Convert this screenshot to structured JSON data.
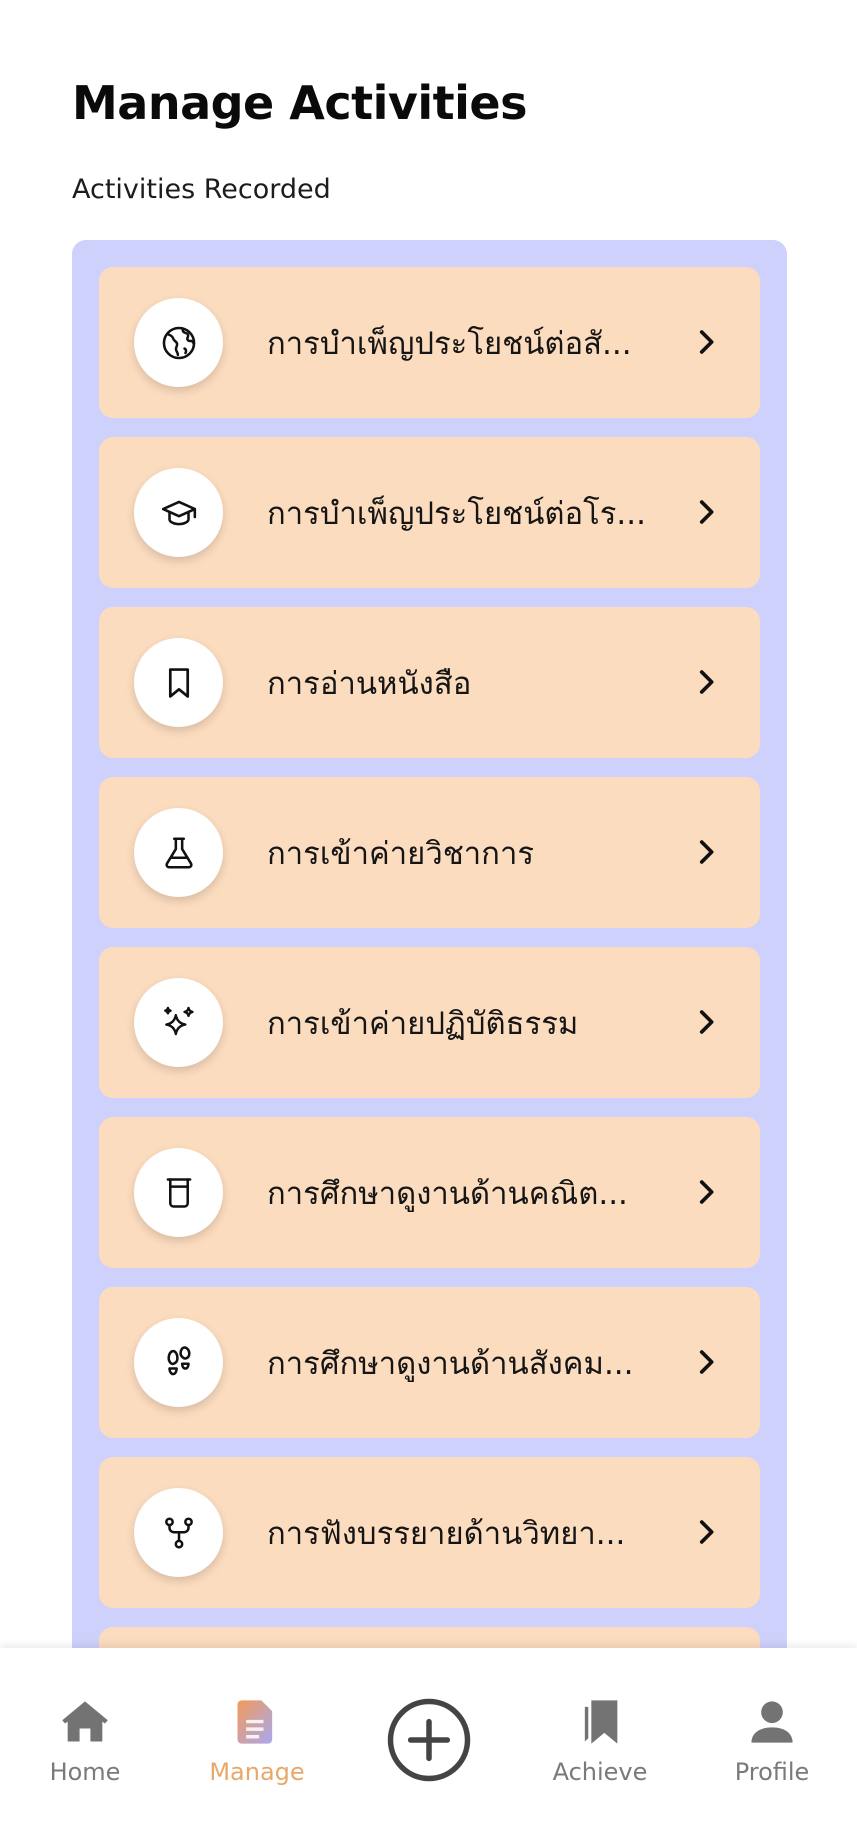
{
  "page": {
    "title": "Manage Activities",
    "subtitle": "Activities Recorded"
  },
  "activities": [
    {
      "label": "การบำเพ็ญประโยชน์ต่อสั...",
      "icon": "globe-icon"
    },
    {
      "label": "การบำเพ็ญประโยชน์ต่อโร...",
      "icon": "graduation-cap-icon"
    },
    {
      "label": "การอ่านหนังสือ",
      "icon": "bookmark-icon"
    },
    {
      "label": "การเข้าค่ายวิชาการ",
      "icon": "flask-icon"
    },
    {
      "label": "การเข้าค่ายปฏิบัติธรรม",
      "icon": "sparkles-icon"
    },
    {
      "label": "การศึกษาดูงานด้านคณิต...",
      "icon": "beaker-icon"
    },
    {
      "label": "การศึกษาดูงานด้านสังคม...",
      "icon": "footprints-icon"
    },
    {
      "label": "การฟังบรรยายด้านวิทยา...",
      "icon": "git-fork-icon"
    }
  ],
  "nav": {
    "items": [
      {
        "label": "Home",
        "icon": "home-icon",
        "active": false
      },
      {
        "label": "Manage",
        "icon": "document-icon",
        "active": true
      },
      {
        "label": "Achieve",
        "icon": "bookmarks-icon",
        "active": false
      },
      {
        "label": "Profile",
        "icon": "user-icon",
        "active": false
      }
    ],
    "add_icon": "plus-circle-icon"
  },
  "colors": {
    "panel": "#cdd1fb",
    "card": "#fcdcbf",
    "active_nav": "#e8a86a",
    "inactive_nav": "#7a7a7a"
  }
}
